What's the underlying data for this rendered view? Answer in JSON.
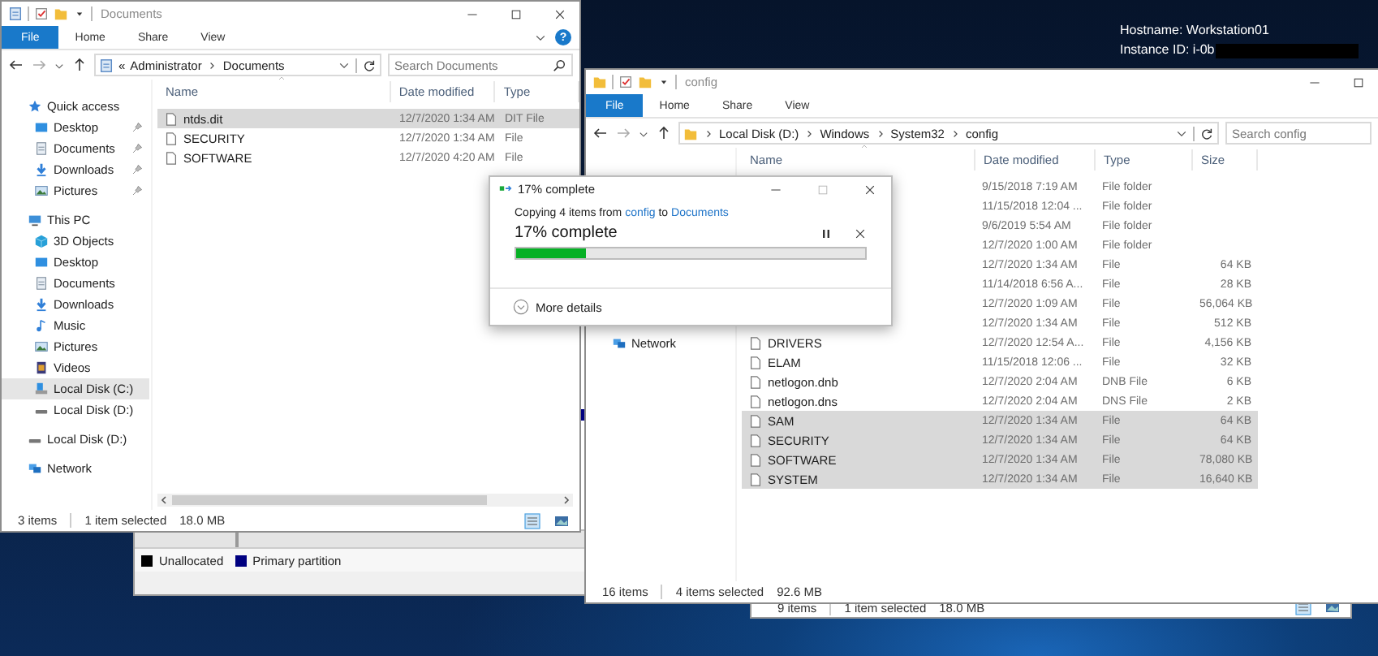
{
  "desktop_info": {
    "lines": [
      {
        "text": "Hostname: Workstation01"
      },
      {
        "text": "Instance ID: i-0b",
        "redacted": true
      }
    ]
  },
  "disk_window": {
    "legend": [
      {
        "label": "Unallocated",
        "color": "#000000"
      },
      {
        "label": "Primary partition",
        "color": "#000080"
      }
    ]
  },
  "back_window": {
    "status_bar": {
      "count": "9 items",
      "selection": "1 item selected",
      "size": "18.0 MB"
    }
  },
  "documents_window": {
    "title": "Documents",
    "controls": [
      {
        "kind": "minimize",
        "disabled": false
      },
      {
        "kind": "maximize",
        "disabled": false
      },
      {
        "kind": "close",
        "disabled": false
      }
    ],
    "ribbon_tabs": [
      {
        "label": "File",
        "kind": "file"
      },
      {
        "label": "Home",
        "kind": "tab"
      },
      {
        "label": "Share",
        "kind": "tab"
      },
      {
        "label": "View",
        "kind": "tab"
      }
    ],
    "help": "?",
    "address": {
      "prefix": "«",
      "parts": [
        "Administrator",
        "Documents"
      ]
    },
    "search": {
      "placeholder": "Search Documents"
    },
    "sidebar": [
      {
        "label": "Quick access",
        "kind": "star",
        "selected": false,
        "pinned": false,
        "children": [
          {
            "label": "Desktop",
            "kind": "desktop",
            "selected": false,
            "pinned": true
          },
          {
            "label": "Documents",
            "kind": "documents",
            "selected": false,
            "pinned": true
          },
          {
            "label": "Downloads",
            "kind": "downloads",
            "selected": false,
            "pinned": true
          },
          {
            "label": "Pictures",
            "kind": "pictures",
            "selected": false,
            "pinned": true
          }
        ]
      },
      {
        "label": "This PC",
        "kind": "pc",
        "selected": false,
        "pinned": false,
        "children": [
          {
            "label": "3D Objects",
            "kind": "cube",
            "selected": false,
            "pinned": false
          },
          {
            "label": "Desktop",
            "kind": "desktop",
            "selected": false,
            "pinned": false
          },
          {
            "label": "Documents",
            "kind": "documents",
            "selected": false,
            "pinned": false
          },
          {
            "label": "Downloads",
            "kind": "downloads",
            "selected": false,
            "pinned": false
          },
          {
            "label": "Music",
            "kind": "music",
            "selected": false,
            "pinned": false
          },
          {
            "label": "Pictures",
            "kind": "pictures",
            "selected": false,
            "pinned": false
          },
          {
            "label": "Videos",
            "kind": "videos",
            "selected": false,
            "pinned": false
          },
          {
            "label": "Local Disk (C:)",
            "kind": "system_drive",
            "selected": true,
            "pinned": false
          },
          {
            "label": "Local Disk (D:)",
            "kind": "drive",
            "selected": false,
            "pinned": false
          }
        ]
      },
      {
        "label": "Local Disk (D:)",
        "kind": "drive",
        "selected": false,
        "pinned": false
      },
      {
        "label": "Network",
        "kind": "network",
        "selected": false,
        "pinned": false
      }
    ],
    "columns": [
      "Name",
      "Date modified",
      "Type"
    ],
    "rows": [
      {
        "name": "ntds.dit",
        "date": "12/7/2020 1:34 AM",
        "type": "DIT File",
        "selected": true
      },
      {
        "name": "SECURITY",
        "date": "12/7/2020 1:34 AM",
        "type": "File",
        "selected": false
      },
      {
        "name": "SOFTWARE",
        "date": "12/7/2020 4:20 AM",
        "type": "File",
        "selected": false
      }
    ],
    "status_bar": {
      "count": "3 items",
      "selection": "1 item selected",
      "size": "18.0 MB"
    }
  },
  "config_window": {
    "title": "config",
    "controls": [
      {
        "kind": "minimize",
        "disabled": false
      },
      {
        "kind": "maximize",
        "disabled": false
      }
    ],
    "ribbon_tabs": [
      {
        "label": "File",
        "kind": "file"
      },
      {
        "label": "Home",
        "kind": "tab"
      },
      {
        "label": "Share",
        "kind": "tab"
      },
      {
        "label": "View",
        "kind": "tab"
      }
    ],
    "address": {
      "parts": [
        "Local Disk (D:)",
        "Windows",
        "System32",
        "config"
      ]
    },
    "search": {
      "placeholder": "Search config"
    },
    "sidebar": [
      {
        "label": "Network",
        "kind": "network",
        "selected": false,
        "pinned": false
      }
    ],
    "columns": [
      "Name",
      "Date modified",
      "Type",
      "Size"
    ],
    "rows": [
      {
        "date": "9/15/2018 7:19 AM",
        "type": "File folder",
        "selected": false
      },
      {
        "date": "11/15/2018 12:04 ...",
        "type": "File folder",
        "selected": false
      },
      {
        "date": "9/6/2019 5:54 AM",
        "type": "File folder",
        "selected": false
      },
      {
        "date": "12/7/2020 1:00 AM",
        "type": "File folder",
        "selected": false
      },
      {
        "date": "12/7/2020 1:34 AM",
        "type": "File",
        "size": "64 KB",
        "selected": false
      },
      {
        "date": "11/14/2018 6:56 A...",
        "type": "File",
        "size": "28 KB",
        "selected": false
      },
      {
        "date": "12/7/2020 1:09 AM",
        "type": "File",
        "size": "56,064 KB",
        "selected": false
      },
      {
        "date": "12/7/2020 1:34 AM",
        "type": "File",
        "size": "512 KB",
        "selected": false
      },
      {
        "name": "DRIVERS",
        "date": "12/7/2020 12:54 A...",
        "type": "File",
        "size": "4,156 KB",
        "selected": false
      },
      {
        "name": "ELAM",
        "date": "11/15/2018 12:06 ...",
        "type": "File",
        "size": "32 KB",
        "selected": false
      },
      {
        "name": "netlogon.dnb",
        "date": "12/7/2020 2:04 AM",
        "type": "DNB File",
        "size": "6 KB",
        "selected": false
      },
      {
        "name": "netlogon.dns",
        "date": "12/7/2020 2:04 AM",
        "type": "DNS File",
        "size": "2 KB",
        "selected": false
      },
      {
        "name": "SAM",
        "date": "12/7/2020 1:34 AM",
        "type": "File",
        "size": "64 KB",
        "selected": true
      },
      {
        "name": "SECURITY",
        "date": "12/7/2020 1:34 AM",
        "type": "File",
        "size": "64 KB",
        "selected": true
      },
      {
        "name": "SOFTWARE",
        "date": "12/7/2020 1:34 AM",
        "type": "File",
        "size": "78,080 KB",
        "selected": true
      },
      {
        "name": "SYSTEM",
        "date": "12/7/2020 1:34 AM",
        "type": "File",
        "size": "16,640 KB",
        "selected": true
      }
    ],
    "status_bar": {
      "count": "16 items",
      "selection": "4 items selected",
      "size": "92.6 MB"
    }
  },
  "copy_dialog": {
    "title": "17% complete",
    "controls": [
      {
        "kind": "minimize",
        "disabled": false
      },
      {
        "kind": "maximize",
        "disabled": true
      },
      {
        "kind": "close",
        "disabled": false
      }
    ],
    "message": [
      {
        "text": "Copying 4 items from ",
        "kind": "text"
      },
      {
        "text": "config",
        "kind": "link"
      },
      {
        "text": " to ",
        "kind": "text"
      },
      {
        "text": "Documents",
        "kind": "link"
      }
    ],
    "heading": "17% complete",
    "level": 0.2,
    "details": "More details"
  }
}
